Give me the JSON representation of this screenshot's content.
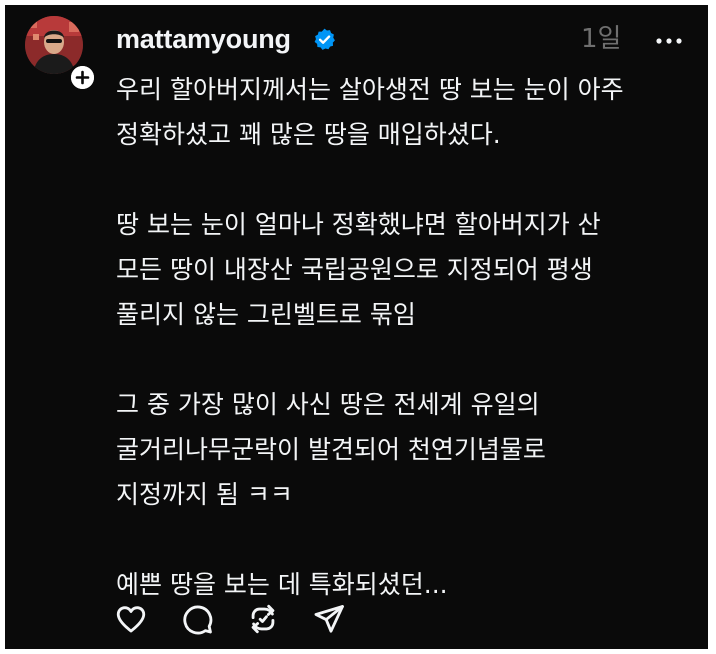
{
  "post": {
    "author": {
      "username": "mattamyoung",
      "verified": true,
      "avatar": "avatar-photo",
      "follow_icon": "plus-icon"
    },
    "timestamp": "1일",
    "more_icon": "more-horizontal-icon",
    "paragraphs": [
      [
        "우리 할아버지께서는 살아생전 땅 보는 눈이 아주",
        "정확하셨고 꽤 많은 땅을 매입하셨다."
      ],
      [
        "땅 보는 눈이 얼마나 정확했냐면 할아버지가 산",
        "모든 땅이 내장산 국립공원으로 지정되어 평생",
        "풀리지 않는 그린벨트로 묶임"
      ],
      [
        "그 중 가장 많이 사신 땅은 전세계 유일의",
        "굴거리나무군락이 발견되어 천연기념물로",
        "지정까지 됨 ㅋㅋ"
      ],
      [
        "예쁜 땅을 보는 데 특화되셨던..."
      ]
    ],
    "actions": [
      {
        "name": "like",
        "icon": "heart-icon"
      },
      {
        "name": "comment",
        "icon": "comment-icon"
      },
      {
        "name": "repost",
        "icon": "repost-icon"
      },
      {
        "name": "share",
        "icon": "send-icon"
      }
    ]
  },
  "colors": {
    "background": "#0a0a0a",
    "text": "#f3f5f7",
    "muted": "#6f6f6f",
    "verified": "#0095f6"
  }
}
